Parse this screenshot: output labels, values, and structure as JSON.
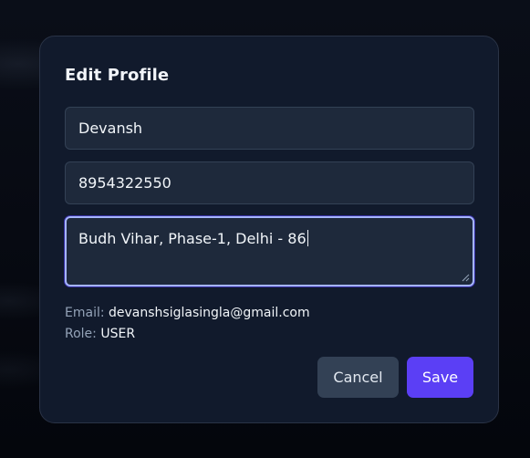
{
  "modal": {
    "title": "Edit Profile",
    "fields": {
      "name": "Devansh",
      "phone": "8954322550",
      "address": "Budh Vihar, Phase-1, Delhi - 86"
    },
    "info": {
      "email_label": "Email:",
      "email_value": "devanshsiglasingla@gmail.com",
      "role_label": "Role:",
      "role_value": "USER"
    },
    "buttons": {
      "cancel": "Cancel",
      "save": "Save"
    }
  },
  "colors": {
    "background": "#050812",
    "modal_bg": "#111a2c",
    "input_bg": "#1e293b",
    "focus_ring": "#a5b4fc",
    "cancel_bg": "#334155",
    "save_bg": "#5b3ff5"
  }
}
